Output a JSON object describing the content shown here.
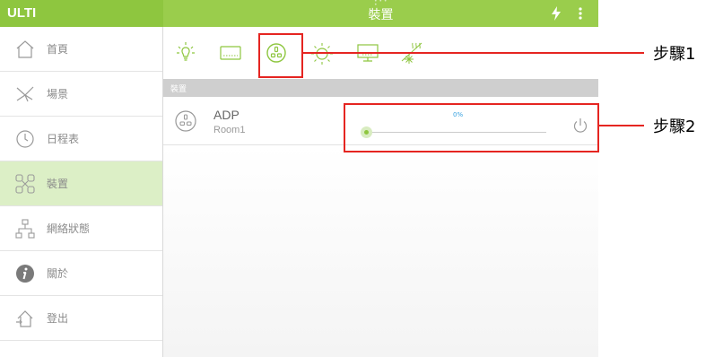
{
  "app": {
    "title": "ULTI"
  },
  "header": {
    "title": "裝置"
  },
  "sidebar": {
    "items": [
      {
        "label": "首頁",
        "icon": "home-icon"
      },
      {
        "label": "場景",
        "icon": "scene-icon"
      },
      {
        "label": "日程表",
        "icon": "clock-icon"
      },
      {
        "label": "裝置",
        "icon": "device-icon",
        "active": true
      },
      {
        "label": "網絡狀態",
        "icon": "network-icon"
      },
      {
        "label": "關於",
        "icon": "info-icon"
      },
      {
        "label": "登出",
        "icon": "logout-icon"
      }
    ]
  },
  "toolbar": {
    "icons": [
      "light-bulb-icon",
      "curtain-icon",
      "smart-plug-icon",
      "dimmer-icon",
      "tv-icon",
      "aircon-icon"
    ],
    "selected": "smart-plug-icon"
  },
  "section": {
    "title": "裝置"
  },
  "device": {
    "name": "ADP",
    "room": "Room1",
    "level_percent": 0,
    "level_label": "0%"
  },
  "annotations": {
    "step1": "步驟1",
    "step2": "步驟2",
    "color": "#e52521"
  },
  "colors": {
    "accent": "#8ec63f",
    "header": "#9acd4c",
    "active_row": "#dcefc6",
    "slider_value": "#35a0df"
  }
}
